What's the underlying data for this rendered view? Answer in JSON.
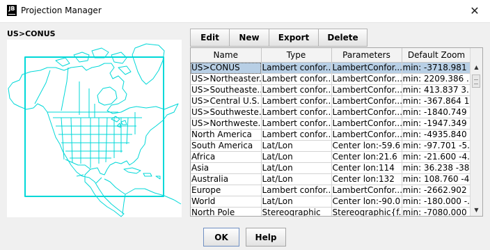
{
  "window": {
    "title": "Projection Manager",
    "app_badge": "JB",
    "close_glyph": "✕"
  },
  "current_projection": "US>CONUS",
  "toolbar": {
    "edit": "Edit",
    "new": "New",
    "export": "Export",
    "delete": "Delete"
  },
  "table": {
    "columns": [
      "Name",
      "Type",
      "Parameters",
      "Default Zoom"
    ],
    "selected_index": 0,
    "rows": [
      [
        "US>CONUS",
        "Lambert confor...",
        "LambertConfor...",
        "min: -3718.981 ..."
      ],
      [
        "US>Northeaster...",
        "Lambert confor...",
        "LambertConfor...",
        "min: 2209.386 ..."
      ],
      [
        "US>Southeaste...",
        "Lambert confor...",
        "LambertConfor...",
        "min: 413.837 3..."
      ],
      [
        "US>Central U.S.",
        "Lambert confor...",
        "LambertConfor...",
        "min: -367.864 1..."
      ],
      [
        "US>Southweste...",
        "Lambert confor...",
        "LambertConfor...",
        "min: -1840.749 ..."
      ],
      [
        "US>Northweste...",
        "Lambert confor...",
        "LambertConfor...",
        "min: -1947.349 ..."
      ],
      [
        "North America",
        "Lambert confor...",
        "LambertConfor...",
        "min: -4935.840 ..."
      ],
      [
        "South America",
        "Lat/Lon",
        "Center lon:-59.6",
        "min: -97.701 -5..."
      ],
      [
        "Africa",
        "Lat/Lon",
        "Center lon:21.6",
        "min: -21.600 -4..."
      ],
      [
        "Asia",
        "Lat/Lon",
        "Center lon:114",
        "min: 36.238 -38..."
      ],
      [
        "Australia",
        "Lat/Lon",
        "Center lon:132",
        "min: 108.760 -4..."
      ],
      [
        "Europe",
        "Lambert confor...",
        "LambertConfor...",
        "min: -2662.902 ..."
      ],
      [
        "World",
        "Lat/Lon",
        "Center lon:-90.0",
        "min: -180.000 -..."
      ],
      [
        "North Pole",
        "Stereographic",
        "Stereographic{f...",
        "min: -7080.000 ..."
      ]
    ]
  },
  "footer": {
    "ok": "OK",
    "help": "Help"
  },
  "colors": {
    "map_lines": "#00d8d8",
    "selection": "#b8cfe5",
    "default_button_border": "#6f8fc2"
  }
}
